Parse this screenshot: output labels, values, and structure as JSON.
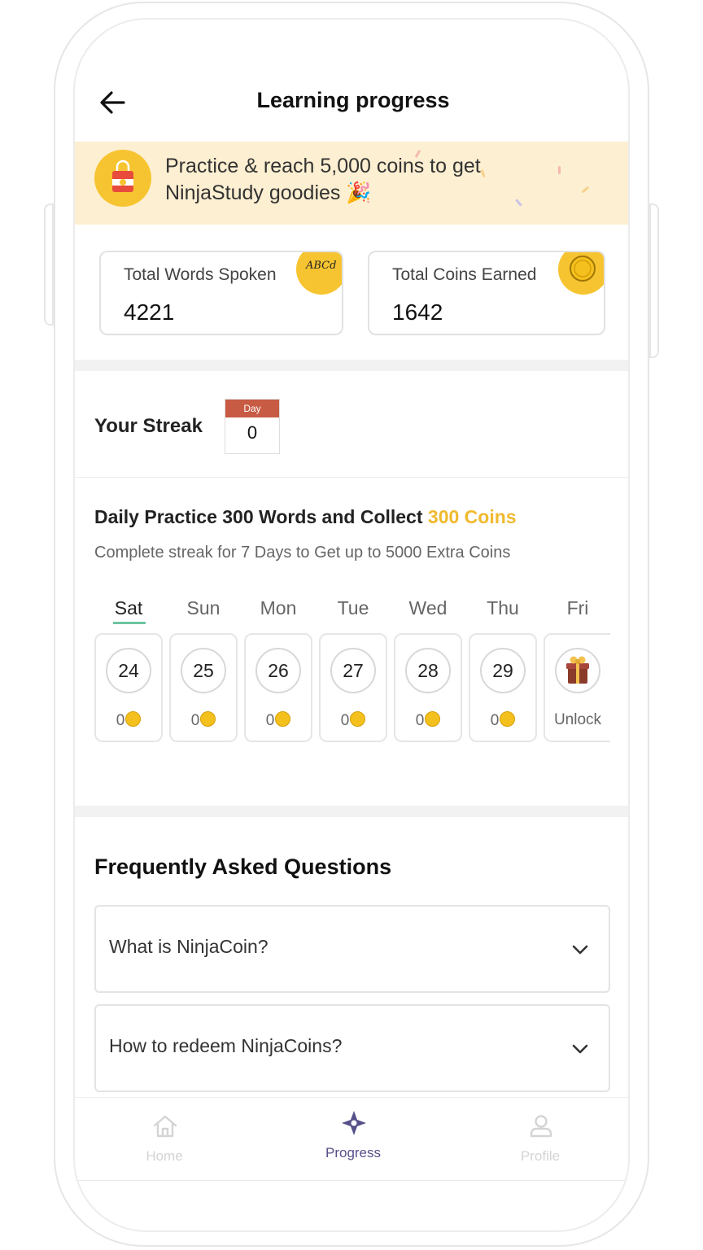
{
  "header": {
    "title": "Learning progress"
  },
  "banner": {
    "line1": "Practice & reach 5,000 coins to get",
    "line2": "NinjaStudy goodies 🎉"
  },
  "stats": {
    "words_label": "Total Words Spoken",
    "words_value": "4221",
    "words_badge": "ABCd",
    "coins_label": "Total Coins Earned",
    "coins_value": "1642"
  },
  "streak": {
    "label": "Your Streak",
    "calendar_header": "Day",
    "calendar_value": "0"
  },
  "daily": {
    "title_prefix": "Daily Practice 300 Words and Collect ",
    "title_coins": "300 Coins",
    "subtitle": "Complete streak for 7 Days to Get up to 5000 Extra Coins"
  },
  "days": [
    {
      "name": "Sat",
      "date": "24",
      "coins": "0"
    },
    {
      "name": "Sun",
      "date": "25",
      "coins": "0"
    },
    {
      "name": "Mon",
      "date": "26",
      "coins": "0"
    },
    {
      "name": "Tue",
      "date": "27",
      "coins": "0"
    },
    {
      "name": "Wed",
      "date": "28",
      "coins": "0"
    },
    {
      "name": "Thu",
      "date": "29",
      "coins": "0"
    },
    {
      "name": "Fri",
      "reward_label": "Unlock"
    }
  ],
  "faq": {
    "title": "Frequently Asked Questions",
    "items": [
      {
        "question": "What is NinjaCoin?"
      },
      {
        "question": "How to redeem NinjaCoins?"
      }
    ]
  },
  "nav": {
    "home": "Home",
    "progress": "Progress",
    "profile": "Profile"
  },
  "colors": {
    "accent_gold": "#f0b92e",
    "banner_bg": "#fdefd1",
    "active_nav": "#55508a",
    "inactive_nav": "#d4d4d4"
  }
}
